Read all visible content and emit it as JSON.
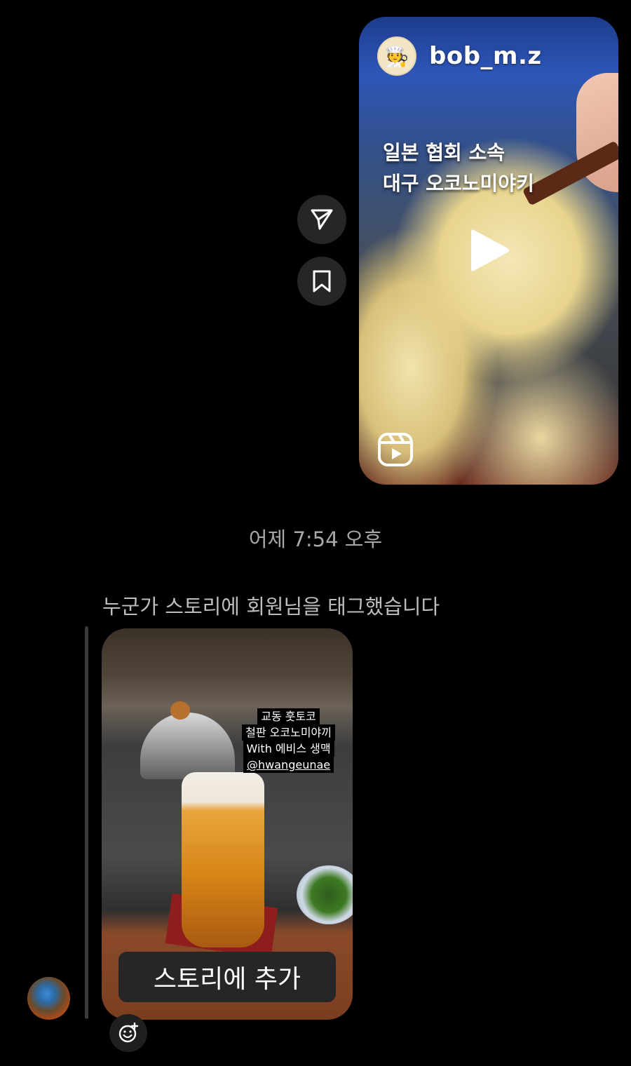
{
  "reel": {
    "username": "bob_m.z",
    "caption_line1": "일본 협회 소속",
    "caption_line2": "대구 오코노미야키"
  },
  "timestamp": "어제 7:54 오후",
  "story_mention": {
    "notice": "누군가 스토리에 회원님을 태그했습니다",
    "tags": [
      "교동 훗토코",
      "철판 오코노미야끼",
      "With 에비스 생맥",
      "@hwangeunae"
    ],
    "add_button_label": "스토리에 추가"
  },
  "icons": {
    "share": "send-icon",
    "save": "bookmark-icon",
    "play": "play-icon",
    "reels": "reels-icon",
    "react": "add-reaction-icon"
  }
}
